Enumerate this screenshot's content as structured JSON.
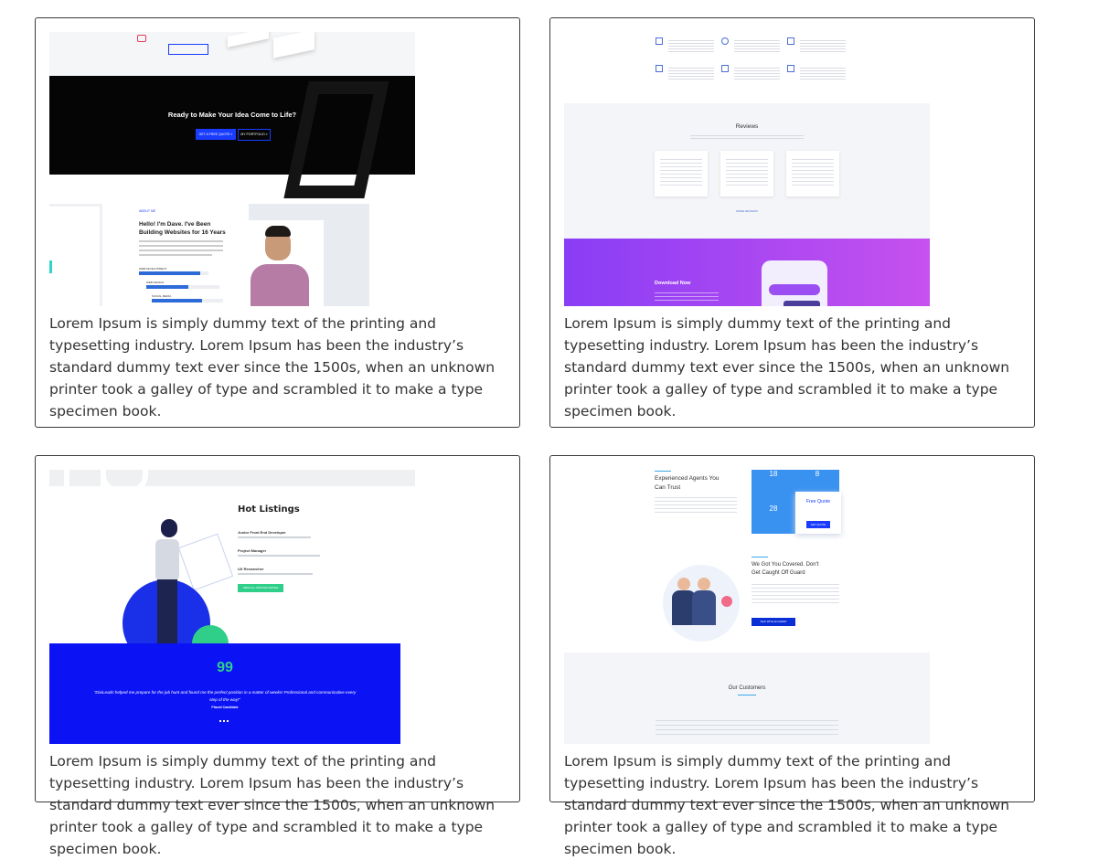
{
  "description": "Lorem Ipsum is simply dummy text of the printing and typesetting industry. Lorem Ipsum has been the industry’s standard dummy text ever since the 1500s, when an unknown printer took a galley of type and scrambled it to make a type specimen book.",
  "cards": [
    {
      "cta": {
        "title": "Ready to Make Your Idea Come to Life?",
        "primary_button": "GET A FREE QUOTE »",
        "secondary_button": "MY PORTFOLIO »"
      },
      "about": {
        "eyebrow": "ABOUT ME",
        "heading_line1": "Hello! I'm Dave. I've Been",
        "heading_line2": "Building Websites for 16 Years",
        "skills": [
          "WEB DEVELOPMENT",
          "WEB DESIGN",
          "SOCIAL MEDIA"
        ]
      }
    },
    {
      "reviews": {
        "heading": "Reviews",
        "button": "MORE REVIEWS"
      },
      "download": {
        "heading": "Download Now"
      }
    },
    {
      "listings": {
        "heading": "Hot Listings",
        "jobs": [
          "Junior Front End Developer",
          "Project Manager",
          "UX Researcher"
        ],
        "button": "VIEW ALL OPPORTUNITIES"
      },
      "testimonial": {
        "quote_mark": "99",
        "quote": "\"DiviLeads helped me prepare for the job hunt and found me the perfect position in a matter of weeks! Professional and communicative every step of the way!\"",
        "author": "Placed Candidate"
      }
    },
    {
      "agents": {
        "heading_line1": "Experienced Agents You",
        "heading_line2": "Can Trust",
        "stats": [
          "18",
          "8",
          "28"
        ],
        "quote_title": "Free Quote",
        "quote_button": "GET QUOTE"
      },
      "covered": {
        "heading_line1": "We Got You Covered. Don't",
        "heading_line2": "Get Caught Off Guard",
        "button": "TALK WITH AN AGENT"
      },
      "customers": {
        "heading": "Our Customers"
      }
    }
  ],
  "colors": {
    "blue_cta": "#1a3cff",
    "purple": "#b14df2",
    "green": "#2fcf8a",
    "border": "#3a3a3a"
  }
}
